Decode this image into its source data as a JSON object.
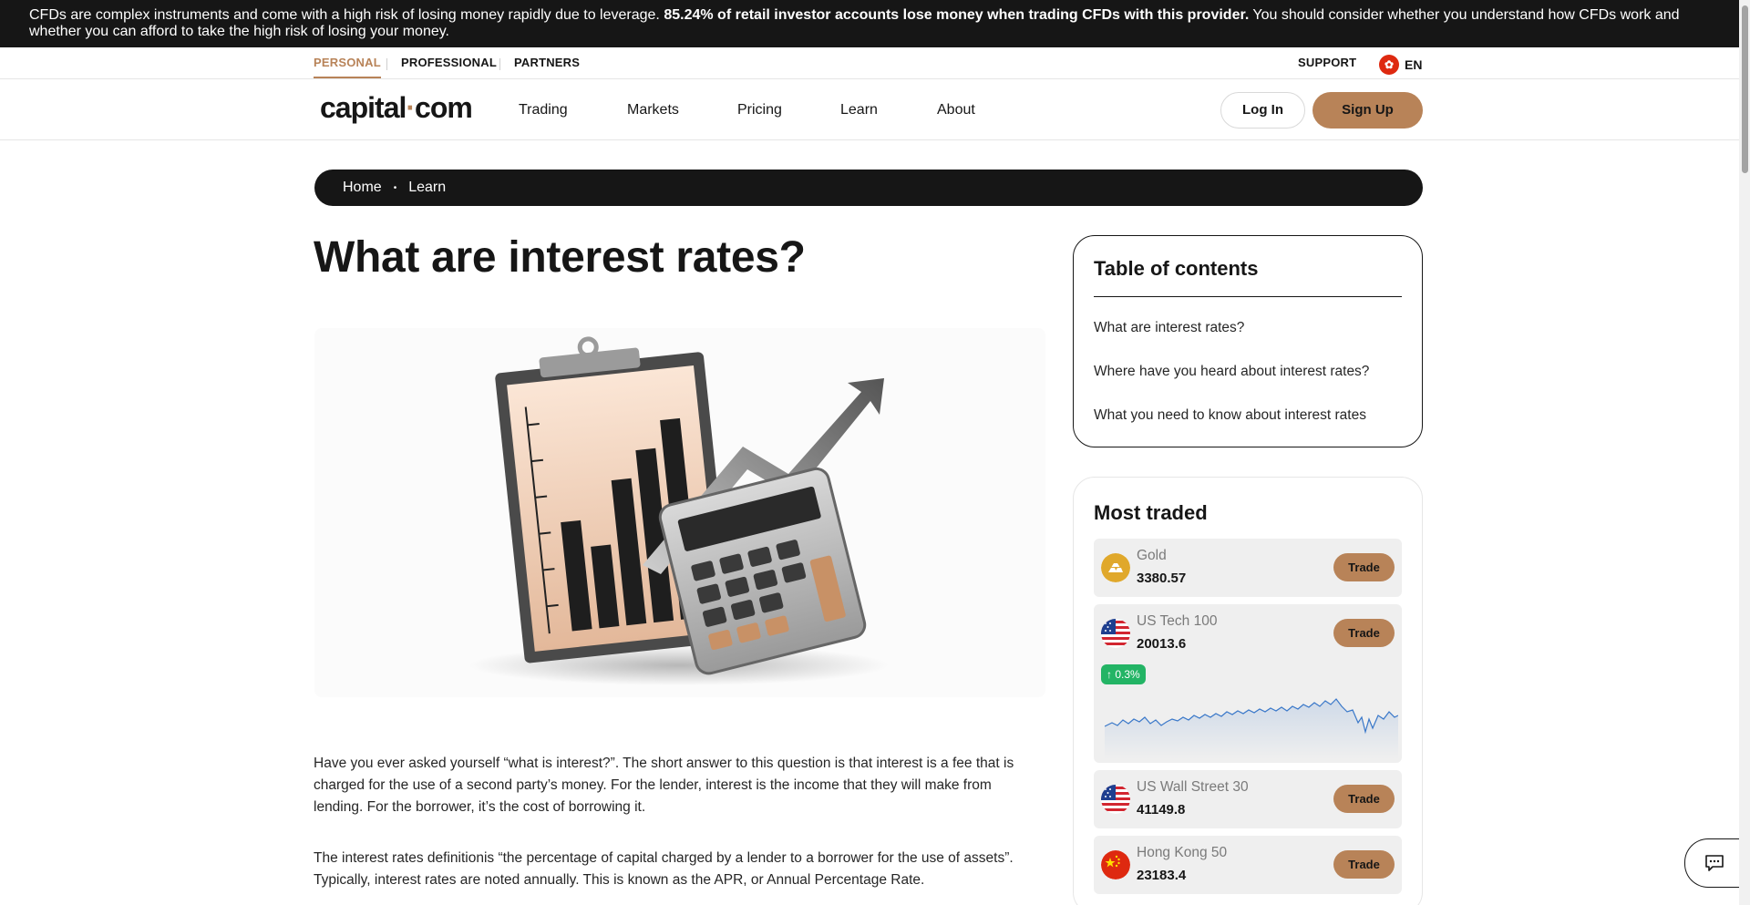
{
  "risk_banner": {
    "text_before": "CFDs are complex instruments and come with a high risk of losing money rapidly due to leverage. ",
    "text_bold": "85.24% of retail investor accounts lose money when trading CFDs with this provider.",
    "text_after": " You should consider whether you understand how CFDs work and whether you can afford to take the high risk of losing your money."
  },
  "subnav": {
    "personal": "PERSONAL",
    "professional": "PROFESSIONAL",
    "partners": "PARTNERS",
    "support": "SUPPORT",
    "language": "EN"
  },
  "header": {
    "logo_left": "capital",
    "logo_dot": "·",
    "logo_right": "com",
    "menu": [
      "Trading",
      "Markets",
      "Pricing",
      "Learn",
      "About"
    ],
    "login": "Log In",
    "signup": "Sign Up"
  },
  "breadcrumb": {
    "home": "Home",
    "sep": "•",
    "current": "Learn"
  },
  "article": {
    "title": "What are interest rates?",
    "paragraph1": "Have you ever asked yourself “what is interest?”. The short answer to this question is that interest is a fee that is charged for the use of a second party’s money. For the lender, interest is the income that they will make from lending. For the borrower, it’s the cost of borrowing it.",
    "paragraph2": "The interest rates definitionis “the percentage of capital charged by a lender to a borrower for the use of assets”. Typically, interest rates are noted annually. This is known as the APR, or Annual Percentage Rate."
  },
  "toc": {
    "title": "Table of contents",
    "links": [
      "What are interest rates?",
      "Where have you heard about interest rates?",
      "What you need to know about interest rates"
    ]
  },
  "most_traded": {
    "title": "Most traded",
    "trade_label": "Trade",
    "items": [
      {
        "name": "Gold",
        "price": "3380.57",
        "icon": "gold-icon"
      },
      {
        "name": "US Tech 100",
        "price": "20013.6",
        "icon": "us-flag-icon",
        "change": "↑ 0.3%"
      },
      {
        "name": "US Wall Street 30",
        "price": "41149.8",
        "icon": "us-flag-icon"
      },
      {
        "name": "Hong Kong 50",
        "price": "23183.4",
        "icon": "china-flag-icon"
      }
    ]
  },
  "colors": {
    "brand": "#b88358",
    "dark": "#161616",
    "positive": "#23b465",
    "chart_line": "#3a78c9"
  }
}
